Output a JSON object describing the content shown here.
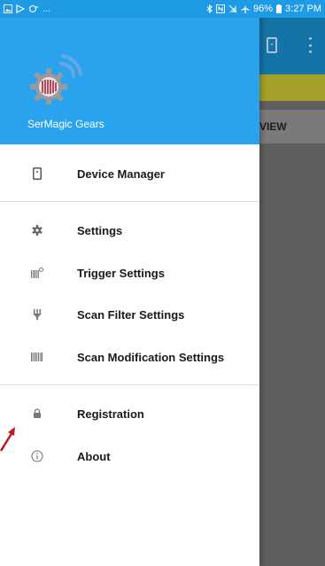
{
  "status_bar": {
    "left_icons": [
      "image-icon",
      "play-store-icon",
      "sync-icon"
    ],
    "left_extra": "...",
    "right_icons": [
      "bluetooth-icon",
      "nfc-icon",
      "signal-off-icon",
      "airplane-icon"
    ],
    "battery": "96%",
    "time": "3:27 PM"
  },
  "drawer": {
    "app_name": "SerMagic Gears",
    "sections": [
      {
        "items": [
          {
            "icon": "device-icon",
            "label": "Device Manager"
          }
        ]
      },
      {
        "items": [
          {
            "icon": "gear-icon",
            "label": "Settings"
          },
          {
            "icon": "trigger-barcode-icon",
            "label": "Trigger Settings"
          },
          {
            "icon": "filter-icon",
            "label": "Scan Filter Settings"
          },
          {
            "icon": "barcode-icon",
            "label": "Scan Modification Settings"
          }
        ]
      },
      {
        "items": [
          {
            "icon": "lock-icon",
            "label": "Registration"
          },
          {
            "icon": "info-icon",
            "label": "About"
          }
        ]
      }
    ]
  },
  "background_app": {
    "tab_label": "VIEW"
  },
  "colors": {
    "status_bar": "#1f9be6",
    "drawer_header": "#2aa3ef",
    "bg_toolbar": "#1474a8",
    "bg_yellow": "#a4a02a",
    "annotation_arrow": "#c0181f"
  }
}
